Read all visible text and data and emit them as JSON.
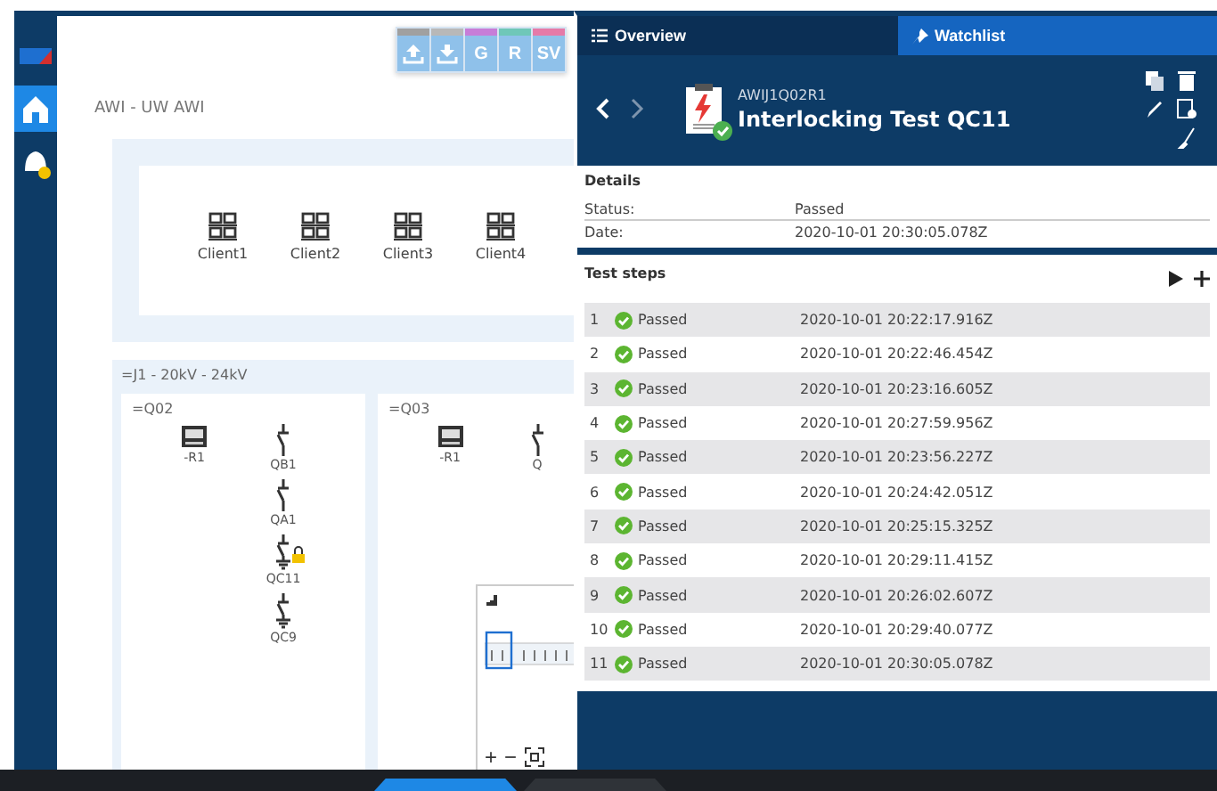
{
  "sidebar": {
    "items": [
      {
        "kind": "logo",
        "selected": false
      },
      {
        "kind": "home",
        "selected": true
      },
      {
        "kind": "alarm",
        "selected": false
      }
    ]
  },
  "canvas": {
    "toolbar": [
      {
        "kind": "upload",
        "color": "#a0a0a0"
      },
      {
        "kind": "download",
        "color": "#b8b8b8"
      },
      {
        "kind": "text",
        "label": "G",
        "color": "#c77dd8"
      },
      {
        "kind": "text",
        "label": "R",
        "color": "#6fc7b8"
      },
      {
        "kind": "text",
        "label": "SV",
        "color": "#e57aa8"
      }
    ],
    "breadcrumb": "AWI - UW AWI",
    "clients": [
      "Client1",
      "Client2",
      "Client3",
      "Client4"
    ],
    "voltage_level": {
      "title": "=J1 - 20kV - 24kV",
      "bays": [
        {
          "title": "=Q02",
          "devices": [
            {
              "kind": "relay",
              "label": "-R1",
              "locked": false
            },
            {
              "kind": "switch",
              "label": "QB1",
              "locked": false
            },
            {
              "kind": "switch",
              "label": "QA1",
              "locked": false
            },
            {
              "kind": "earth",
              "label": "QC11",
              "locked": true
            },
            {
              "kind": "earth",
              "label": "QC9",
              "locked": false
            }
          ]
        },
        {
          "title": "=Q03",
          "devices": [
            {
              "kind": "relay",
              "label": "-R1",
              "locked": false
            },
            {
              "kind": "switch",
              "label": "Q",
              "locked": false
            }
          ]
        }
      ]
    },
    "minimap": {
      "zoom_in": "+",
      "zoom_out": "−"
    }
  },
  "panel": {
    "tabs": [
      {
        "kind": "list",
        "label": "Overview",
        "selected": true
      },
      {
        "kind": "pin",
        "label": "Watchlist",
        "selected": false
      }
    ],
    "header": {
      "id": "AWIJ1Q02R1",
      "title": "Interlocking Test QC11",
      "passed": true
    },
    "details": {
      "title": "Details",
      "fields": [
        {
          "label": "Status:",
          "value": "Passed"
        },
        {
          "label": "Date:",
          "value": "2020-10-01 20:30:05.078Z"
        }
      ]
    },
    "test_steps": {
      "title": "Test steps",
      "rows": [
        {
          "number": "1",
          "status": "Passed",
          "passed": true,
          "time": "2020-10-01 20:22:17.916Z"
        },
        {
          "number": "2",
          "status": "Passed",
          "passed": true,
          "time": "2020-10-01 20:22:46.454Z"
        },
        {
          "number": "3",
          "status": "Passed",
          "passed": true,
          "time": "2020-10-01 20:23:16.605Z"
        },
        {
          "number": "4",
          "status": "Passed",
          "passed": true,
          "time": "2020-10-01 20:27:59.956Z"
        },
        {
          "number": "5",
          "status": "Passed",
          "passed": true,
          "time": "2020-10-01 20:23:56.227Z"
        },
        {
          "number": "6",
          "status": "Passed",
          "passed": true,
          "time": "2020-10-01 20:24:42.051Z"
        },
        {
          "number": "7",
          "status": "Passed",
          "passed": true,
          "time": "2020-10-01 20:25:15.325Z"
        },
        {
          "number": "8",
          "status": "Passed",
          "passed": true,
          "time": "2020-10-01 20:29:11.415Z"
        },
        {
          "number": "9",
          "status": "Passed",
          "passed": true,
          "time": "2020-10-01 20:26:02.607Z"
        },
        {
          "number": "10",
          "status": "Passed",
          "passed": true,
          "time": "2020-10-01 20:29:40.077Z"
        },
        {
          "number": "11",
          "status": "Passed",
          "passed": true,
          "time": "2020-10-01 20:30:05.078Z"
        }
      ]
    }
  }
}
